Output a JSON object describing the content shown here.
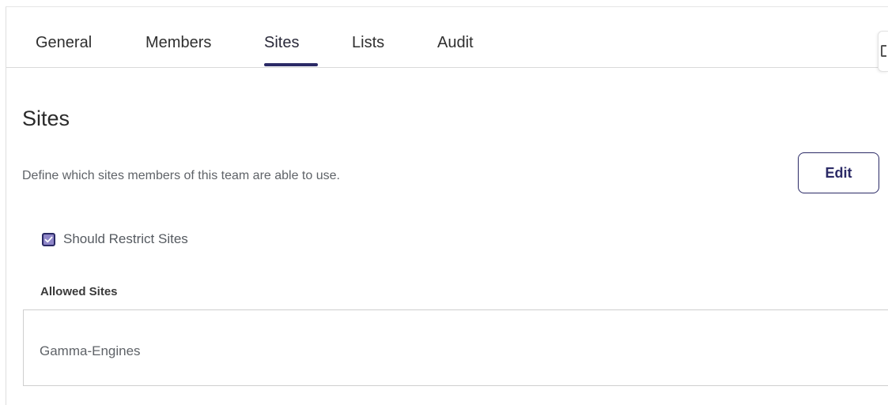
{
  "tabs": [
    {
      "label": "General",
      "active": false
    },
    {
      "label": "Members",
      "active": false
    },
    {
      "label": "Sites",
      "active": true
    },
    {
      "label": "Lists",
      "active": false
    },
    {
      "label": "Audit",
      "active": false
    }
  ],
  "side_panel_toggle": {
    "icon": "panel-toggle-icon"
  },
  "section": {
    "title": "Sites",
    "description": "Define which sites members of this team are able to use.",
    "edit_label": "Edit"
  },
  "restrict": {
    "label": "Should Restrict Sites",
    "checked": true
  },
  "allowed_sites": {
    "label": "Allowed Sites",
    "items": [
      "Gamma-Engines"
    ]
  },
  "colors": {
    "accent": "#2b2a66",
    "checkbox_fill": "#8f86c8",
    "muted_text": "#5f6368"
  }
}
